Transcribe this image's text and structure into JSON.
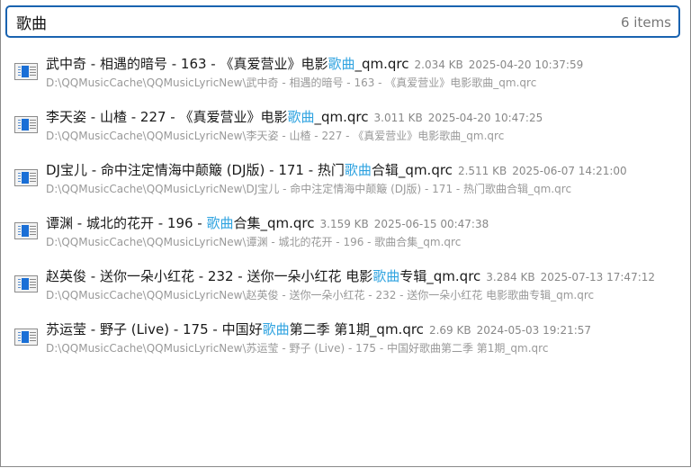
{
  "search": {
    "query": "歌曲",
    "count": "6 items"
  },
  "results": [
    {
      "pre": "武中奇 - 相遇的暗号 - 163 - 《真爱营业》电影",
      "hl": "歌曲",
      "post": "_qm.qrc",
      "size": "2.034 KB",
      "date": "2025-04-20 10:37:59",
      "path": "D:\\QQMusicCache\\QQMusicLyricNew\\武中奇 - 相遇的暗号 - 163 - 《真爱营业》电影歌曲_qm.qrc"
    },
    {
      "pre": "李天姿 - 山楂 - 227 - 《真爱营业》电影",
      "hl": "歌曲",
      "post": "_qm.qrc",
      "size": "3.011 KB",
      "date": "2025-04-20 10:47:25",
      "path": "D:\\QQMusicCache\\QQMusicLyricNew\\李天姿 - 山楂 - 227 - 《真爱营业》电影歌曲_qm.qrc"
    },
    {
      "pre": "DJ宝儿 - 命中注定情海中颠簸 (DJ版) - 171 - 热门",
      "hl": "歌曲",
      "post": "合辑_qm.qrc",
      "size": "2.511 KB",
      "date": "2025-06-07 14:21:00",
      "path": "D:\\QQMusicCache\\QQMusicLyricNew\\DJ宝儿 - 命中注定情海中颠簸 (DJ版) - 171 - 热门歌曲合辑_qm.qrc"
    },
    {
      "pre": "谭渊 - 城北的花开 - 196 - ",
      "hl": "歌曲",
      "post": "合集_qm.qrc",
      "size": "3.159 KB",
      "date": "2025-06-15 00:47:38",
      "path": "D:\\QQMusicCache\\QQMusicLyricNew\\谭渊 - 城北的花开 - 196 - 歌曲合集_qm.qrc"
    },
    {
      "pre": "赵英俊 - 送你一朵小红花 - 232 - 送你一朵小红花 电影",
      "hl": "歌曲",
      "post": "专辑_qm.qrc",
      "size": "3.284 KB",
      "date": "2025-07-13 17:47:12",
      "path": "D:\\QQMusicCache\\QQMusicLyricNew\\赵英俊 - 送你一朵小红花 - 232 - 送你一朵小红花 电影歌曲专辑_qm.qrc"
    },
    {
      "pre": "苏运莹 - 野子 (Live) - 175 - 中国好",
      "hl": "歌曲",
      "post": "第二季 第1期_qm.qrc",
      "size": "2.69 KB",
      "date": "2024-05-03 19:21:57",
      "path": "D:\\QQMusicCache\\QQMusicLyricNew\\苏运莹 - 野子 (Live) - 175 - 中国好歌曲第二季 第1期_qm.qrc"
    }
  ]
}
